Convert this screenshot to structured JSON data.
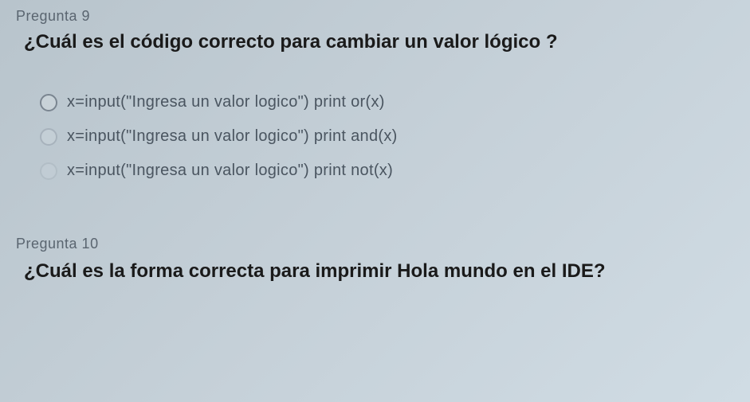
{
  "question9": {
    "label": "Pregunta 9",
    "title": "¿Cuál es el código correcto para cambiar un valor lógico ?",
    "options": [
      "x=input(\"Ingresa un valor logico\") print or(x)",
      "x=input(\"Ingresa un valor logico\") print and(x)",
      "x=input(\"Ingresa un valor logico\") print not(x)"
    ]
  },
  "question10": {
    "label": "Pregunta 10",
    "title": "¿Cuál es la forma correcta para imprimir Hola mundo en el IDE?"
  }
}
